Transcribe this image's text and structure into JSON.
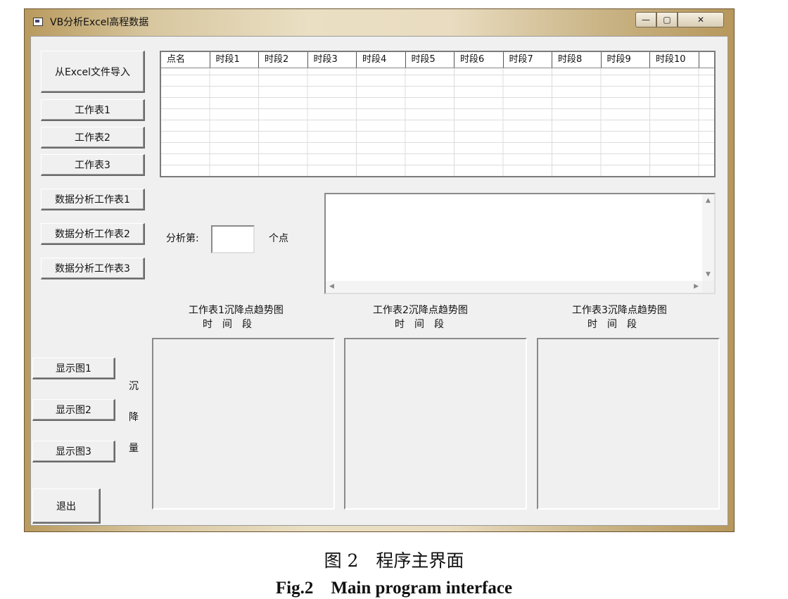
{
  "window": {
    "title": "VB分析Excel高程数据",
    "controls": {
      "minimize": "—",
      "maximize": "▢",
      "close": "✕"
    }
  },
  "buttons": {
    "import": "从Excel文件导入",
    "sheet1": "工作表1",
    "sheet2": "工作表2",
    "sheet3": "工作表3",
    "analyze1": "数据分析工作表1",
    "analyze2": "数据分析工作表2",
    "analyze3": "数据分析工作表3",
    "show1": "显示图1",
    "show2": "显示图2",
    "show3": "显示图3",
    "exit": "退出"
  },
  "grid": {
    "headers": [
      "点名",
      "时段1",
      "时段2",
      "时段3",
      "时段4",
      "时段5",
      "时段6",
      "时段7",
      "时段8",
      "时段9",
      "时段10"
    ]
  },
  "analysis": {
    "prefix": "分析第:",
    "suffix": "个点",
    "input_value": ""
  },
  "charts": [
    {
      "title": "工作表1沉降点趋势图",
      "xlabel": "时　间　段"
    },
    {
      "title": "工作表2沉降点趋势图",
      "xlabel": "时　间　段"
    },
    {
      "title": "工作表3沉降点趋势图",
      "xlabel": "时　间　段"
    }
  ],
  "ylabel": [
    "沉",
    "降",
    "量"
  ],
  "caption": {
    "cn": "图 2　程序主界面",
    "en": "Fig.2　Main program interface"
  }
}
